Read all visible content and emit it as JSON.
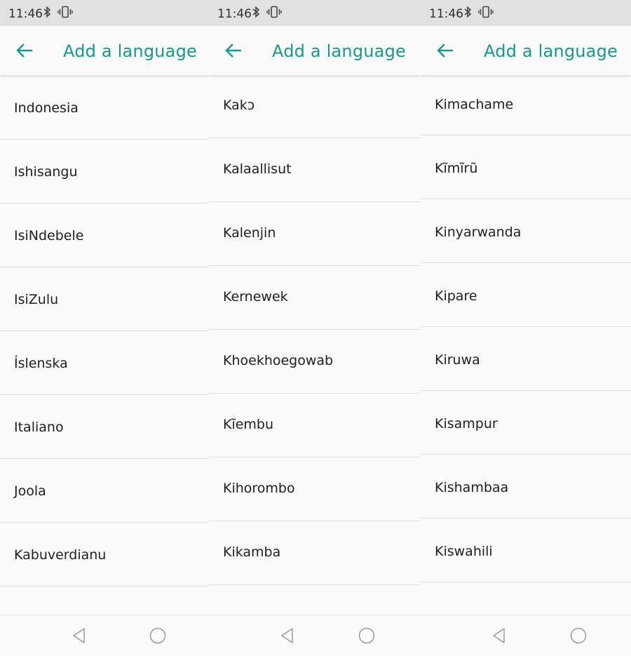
{
  "status": {
    "time": "11:46"
  },
  "appbar": {
    "title": "Add a language",
    "back_icon": "arrow-left-icon"
  },
  "colors": {
    "accent": "#14998a",
    "statusbar": "#e1e1e1",
    "background": "#fafafa",
    "divider": "#e2e2e2"
  },
  "panels": [
    {
      "items": [
        "Indonesia",
        "Ishisangu",
        "IsiNdebele",
        "IsiZulu",
        "Íslenska",
        "Italiano",
        "Joola",
        "Kabuverdianu",
        ""
      ]
    },
    {
      "items": [
        "Kakɔ",
        "Kalaallisut",
        "Kalenjin",
        "Kernewek",
        "Khoekhoegowab",
        "Kĩembu",
        "Kihorombo",
        "Kikamba",
        ""
      ]
    },
    {
      "items": [
        "Kimachame",
        "Kĩmĩrũ",
        "Kinyarwanda",
        "Kipare",
        "Kiruwa",
        "Kisampur",
        "Kishambaa",
        "Kiswahili",
        ""
      ]
    }
  ],
  "navbar": {
    "back_icon": "triangle-back-icon",
    "home_icon": "circle-home-icon"
  }
}
